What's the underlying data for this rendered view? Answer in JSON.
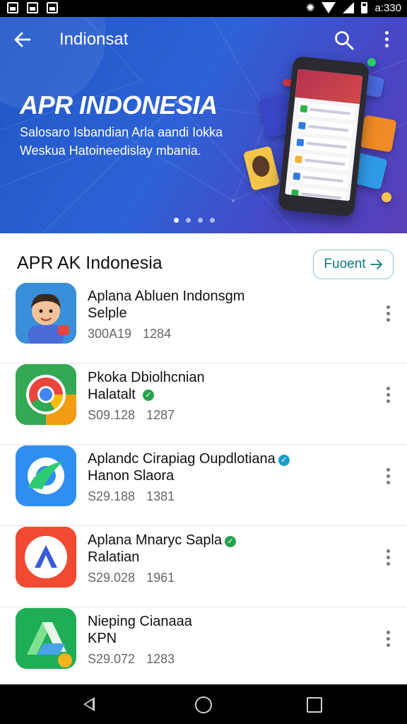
{
  "status_bar": {
    "time": "a:330"
  },
  "header": {
    "title": "Indionsat",
    "back_icon": "arrow-left-icon",
    "search_icon": "search-icon",
    "more_icon": "more-vertical-icon"
  },
  "banner": {
    "headline": "APR INDONESIA",
    "subline": "Salosaro Isbandian Arla aandi Iokka Weskua Hatoineedislay mbania.",
    "page_count": 4,
    "active_page": 1
  },
  "section": {
    "title": "APR AK  Indonesia",
    "action_label": "Fuoent"
  },
  "apps": [
    {
      "title": "Aplana Abluen Indonsgm",
      "subtitle": "Selple",
      "verified": false,
      "meta1": "300A19",
      "meta2": "1284",
      "icon": "person-avatar-icon",
      "icon_bg": "#3a8fd9"
    },
    {
      "title": "Pkoka Dbiolhcnian",
      "subtitle": "Halatalt",
      "verified": true,
      "verified_color": "#22a34a",
      "meta1": "S09.128",
      "meta2": "1287",
      "icon": "chrome-browser-icon",
      "icon_bg": "#34a853"
    },
    {
      "title": "Aplandc Cirapiag Oupdlotiana",
      "subtitle": "Hanon Slaora",
      "verified": true,
      "verified_color": "#1aa0c8",
      "meta1": "S29.188",
      "meta2": "1381",
      "icon": "sync-arrow-icon",
      "icon_bg": "#2f8ef2"
    },
    {
      "title": "Aplana Mnaryc Sapla",
      "subtitle": "Ralatian",
      "verified": true,
      "verified_color": "#22a34a",
      "meta1": "S29.028",
      "meta2": "1961",
      "icon": "letter-a-icon",
      "icon_bg": "#f04a30"
    },
    {
      "title": "Nieping Cianaaa",
      "subtitle": "KPN",
      "verified": false,
      "meta1": "S29.072",
      "meta2": "1283",
      "icon": "drive-triangle-icon",
      "icon_bg": "#1fae55"
    }
  ],
  "nav_bar": {
    "back_icon": "nav-back-icon",
    "home_icon": "nav-home-icon",
    "recent_icon": "nav-recent-icon"
  }
}
